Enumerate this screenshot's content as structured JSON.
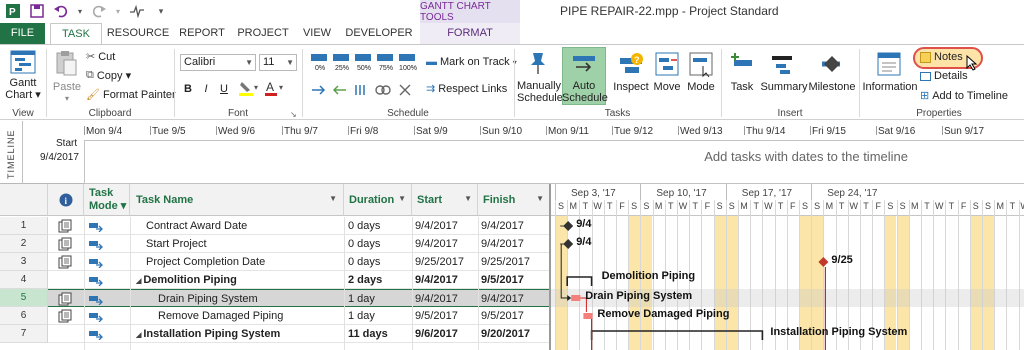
{
  "window": {
    "title": "PIPE REPAIR-22.mpp - Project Standard",
    "contextual_group": "GANTT CHART TOOLS"
  },
  "tabs": [
    "FILE",
    "TASK",
    "RESOURCE",
    "REPORT",
    "PROJECT",
    "VIEW",
    "DEVELOPER",
    "FORMAT"
  ],
  "ribbon": {
    "view": {
      "button": "Gantt Chart",
      "button_l1": "Gantt",
      "button_l2": "Chart ▾",
      "group": "View"
    },
    "clipboard": {
      "paste": "Paste",
      "cut": "Cut",
      "copy": "Copy ▾",
      "format_painter": "Format Painter",
      "group": "Clipboard"
    },
    "font": {
      "family": "Calibri",
      "size": "11",
      "bold": "B",
      "italic": "I",
      "underline": "U",
      "group": "Font"
    },
    "schedule": {
      "pct": [
        "0%",
        "25%",
        "50%",
        "75%",
        "100%"
      ],
      "mark_on_track": "Mark on Track",
      "respect_links": "Respect Links",
      "group": "Schedule"
    },
    "tasks": {
      "manual_l1": "Manually",
      "manual_l2": "Schedule",
      "auto_l1": "Auto",
      "auto_l2": "Schedule",
      "inspect": "Inspect",
      "move": "Move",
      "mode": "Mode",
      "group": "Tasks"
    },
    "insert": {
      "task": "Task",
      "summary": "Summary",
      "milestone": "Milestone",
      "group": "Insert"
    },
    "properties": {
      "information": "Information",
      "notes": "Notes",
      "details": "Details",
      "add_to_timeline": "Add to Timeline",
      "group": "Properties"
    }
  },
  "timeline": {
    "label": "TIMELINE",
    "start_label": "Start",
    "start_date": "9/4/2017",
    "dates": [
      "Mon 9/4",
      "Tue 9/5",
      "Wed 9/6",
      "Thu 9/7",
      "Fri 9/8",
      "Sat 9/9",
      "Sun 9/10",
      "Mon 9/11",
      "Tue 9/12",
      "Wed 9/13",
      "Thu 9/14",
      "Fri 9/15",
      "Sat 9/16",
      "Sun 9/17"
    ],
    "placeholder": "Add tasks with dates to the timeline"
  },
  "table": {
    "headers": {
      "task_mode_l1": "Task",
      "task_mode_l2": "Mode ▾",
      "task_name": "Task Name",
      "duration": "Duration",
      "start": "Start",
      "finish": "Finish"
    },
    "rows": [
      {
        "num": "1",
        "name": "Contract Award Date",
        "duration": "0 days",
        "start": "9/4/2017",
        "finish": "9/4/2017",
        "summary": false
      },
      {
        "num": "2",
        "name": "Start Project",
        "duration": "0 days",
        "start": "9/4/2017",
        "finish": "9/4/2017",
        "summary": false
      },
      {
        "num": "3",
        "name": "Project Completion Date",
        "duration": "0 days",
        "start": "9/25/2017",
        "finish": "9/25/2017",
        "summary": false
      },
      {
        "num": "4",
        "name": "Demolition Piping",
        "duration": "2 days",
        "start": "9/4/2017",
        "finish": "9/5/2017",
        "summary": true
      },
      {
        "num": "5",
        "name": "Drain Piping System",
        "duration": "1 day",
        "start": "9/4/2017",
        "finish": "9/4/2017",
        "summary": false
      },
      {
        "num": "6",
        "name": "Remove Damaged Piping",
        "duration": "1 day",
        "start": "9/5/2017",
        "finish": "9/5/2017",
        "summary": false
      },
      {
        "num": "7",
        "name": "Installation Piping System",
        "duration": "11 days",
        "start": "9/6/2017",
        "finish": "9/20/2017",
        "summary": true
      }
    ]
  },
  "gantt": {
    "weeks": [
      "Sep 3, '17",
      "Sep 10, '17",
      "Sep 17, '17",
      "Sep 24, '17"
    ],
    "day_letters": [
      "S",
      "M",
      "T",
      "W",
      "T",
      "F",
      "S"
    ],
    "labels": {
      "r1": "9/4",
      "r2": "9/4",
      "r3": "9/25",
      "r4": "Demolition Piping",
      "r5": "Drain Piping System",
      "r6": "Remove Damaged Piping",
      "r7": "Installation Piping System"
    }
  },
  "colors": {
    "accent": "#217346",
    "weekend": "#fbe5a8",
    "bar": "#f4807c",
    "selected_row": "#d6d6d6",
    "highlight_circle": "#e0504a"
  }
}
